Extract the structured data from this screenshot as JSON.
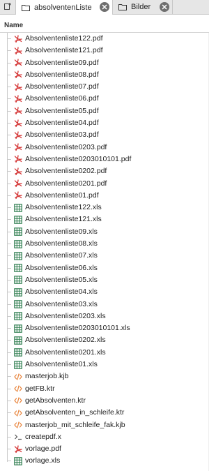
{
  "tabs": [
    {
      "label": "absolventenListe",
      "icon": "folder-icon",
      "active": true
    },
    {
      "label": "Bilder",
      "icon": "folder-icon",
      "active": false
    }
  ],
  "header": {
    "name_col": "Name"
  },
  "files": [
    {
      "name": "Absolventenliste122.pdf",
      "type": "pdf"
    },
    {
      "name": "Absolventenliste121.pdf",
      "type": "pdf"
    },
    {
      "name": "Absolventenliste09.pdf",
      "type": "pdf"
    },
    {
      "name": "Absolventenliste08.pdf",
      "type": "pdf"
    },
    {
      "name": "Absolventenliste07.pdf",
      "type": "pdf"
    },
    {
      "name": "Absolventenliste06.pdf",
      "type": "pdf"
    },
    {
      "name": "Absolventenliste05.pdf",
      "type": "pdf"
    },
    {
      "name": "Absolventenliste04.pdf",
      "type": "pdf"
    },
    {
      "name": "Absolventenliste03.pdf",
      "type": "pdf"
    },
    {
      "name": "Absolventenliste0203.pdf",
      "type": "pdf"
    },
    {
      "name": "Absolventenliste0203010101.pdf",
      "type": "pdf"
    },
    {
      "name": "Absolventenliste0202.pdf",
      "type": "pdf"
    },
    {
      "name": "Absolventenliste0201.pdf",
      "type": "pdf"
    },
    {
      "name": "Absolventenliste01.pdf",
      "type": "pdf"
    },
    {
      "name": "Absolventenliste122.xls",
      "type": "xls"
    },
    {
      "name": "Absolventenliste121.xls",
      "type": "xls"
    },
    {
      "name": "Absolventenliste09.xls",
      "type": "xls"
    },
    {
      "name": "Absolventenliste08.xls",
      "type": "xls"
    },
    {
      "name": "Absolventenliste07.xls",
      "type": "xls"
    },
    {
      "name": "Absolventenliste06.xls",
      "type": "xls"
    },
    {
      "name": "Absolventenliste05.xls",
      "type": "xls"
    },
    {
      "name": "Absolventenliste04.xls",
      "type": "xls"
    },
    {
      "name": "Absolventenliste03.xls",
      "type": "xls"
    },
    {
      "name": "Absolventenliste0203.xls",
      "type": "xls"
    },
    {
      "name": "Absolventenliste0203010101.xls",
      "type": "xls"
    },
    {
      "name": "Absolventenliste0202.xls",
      "type": "xls"
    },
    {
      "name": "Absolventenliste0201.xls",
      "type": "xls"
    },
    {
      "name": "Absolventenliste01.xls",
      "type": "xls"
    },
    {
      "name": "masterjob.kjb",
      "type": "code"
    },
    {
      "name": "getFB.ktr",
      "type": "code"
    },
    {
      "name": "getAbsolventen.ktr",
      "type": "code"
    },
    {
      "name": "getAbsolventen_in_schleife.ktr",
      "type": "code"
    },
    {
      "name": "masterjob_mit_schleife_fak.kjb",
      "type": "code"
    },
    {
      "name": "createpdf.x",
      "type": "terminal"
    },
    {
      "name": "vorlage.pdf",
      "type": "pdf"
    },
    {
      "name": "vorlage.xls",
      "type": "xls"
    }
  ],
  "colors": {
    "pdf": "#d32f2f",
    "xls": "#2e7d4f",
    "code": "#e8833a",
    "terminal": "#555555",
    "tab_close": "#6f6f6f"
  }
}
